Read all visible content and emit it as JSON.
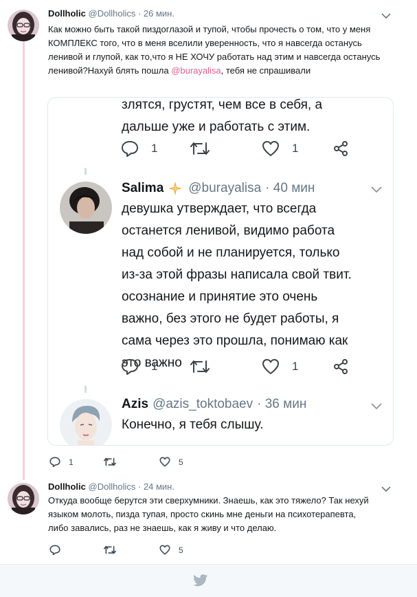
{
  "tweet1": {
    "name": "Dollholic",
    "handle": "@Dollholics",
    "time": "· 26 мин.",
    "text_before_mention": "Как можно быть такой пиздоглазой и тупой, чтобы прочесть о том, что у меня КОМПЛЕКС того, что в меня вселили уверенность, что я навсегда останусь ленивой и глупой, как то,что я НЕ ХОЧУ работать над этим и навсегда останусь ленивой?Нахуй блять пошла ",
    "mention": "@burayalisa",
    "text_after_mention": ", тебя не спрашивали",
    "replies": "1",
    "likes": "5"
  },
  "quote": {
    "prev_text": [
      "злятся, грустят, чем все в себя, а",
      "дальше уже и работать с этим."
    ],
    "prev_replies": "1",
    "prev_likes": "1",
    "salima": {
      "name": "Salima",
      "badge_icon": "sparkle-badge-icon",
      "handle": "@burayalisa",
      "time": "· 40 мин",
      "text": [
        "девушка утверждает, что всегда",
        "останется ленивой, видимо работа",
        "над собой и не планируется, только",
        "из-за этой фразы написала свой твит.",
        "осознание и принятие это очень",
        "важно, без этого не будет работы, я",
        "сама через это прошла, понимаю как",
        "это важно"
      ],
      "replies": "1",
      "likes": "1"
    },
    "azis": {
      "name": "Azis",
      "handle": "@azis_toktobaev",
      "time": "· 36 мин",
      "text": "Конечно, я тебя слышу."
    }
  },
  "tweet2": {
    "name": "Dollholic",
    "handle": "@Dollholics",
    "time": "· 24 мин.",
    "text": [
      "Откуда вообще берутся эти сверхумники. Знаешь, как это тяжело? Так нехуй",
      "языком молоть, пизда тупая, просто скинь мне деньги на психотерапевта,",
      "либо завались,  раз не знаешь, как я живу и что делаю."
    ],
    "likes": "5"
  },
  "colors": {
    "mention": "#e0608c",
    "thread_line": "#f6cfd9",
    "badge": "#f0a63a",
    "footer_bird": "#aab8c2"
  }
}
